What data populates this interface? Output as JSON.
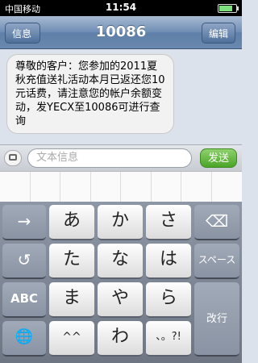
{
  "status_bar": {
    "carrier": "中国移动",
    "time": "11:54"
  },
  "nav": {
    "back_label": "信息",
    "title": "10086",
    "edit_label": "编辑"
  },
  "message": {
    "text": "尊敬的客户：您参加的2011夏秋充值送礼活动本月已返还您10元话费，请注意您的帐户余额变动，发YECX至10086可进行查询"
  },
  "input": {
    "placeholder": "文本信息",
    "send_label": "发送"
  },
  "keyboard": {
    "rows": [
      [
        "→",
        "あ",
        "か",
        "さ",
        "⌫"
      ],
      [
        "↺",
        "た",
        "な",
        "は",
        "スペース"
      ],
      [
        "ABC",
        "ま",
        "や",
        "ら",
        "改行"
      ],
      [
        "🌐",
        "^^",
        "わ",
        "、。?!",
        ""
      ]
    ]
  }
}
